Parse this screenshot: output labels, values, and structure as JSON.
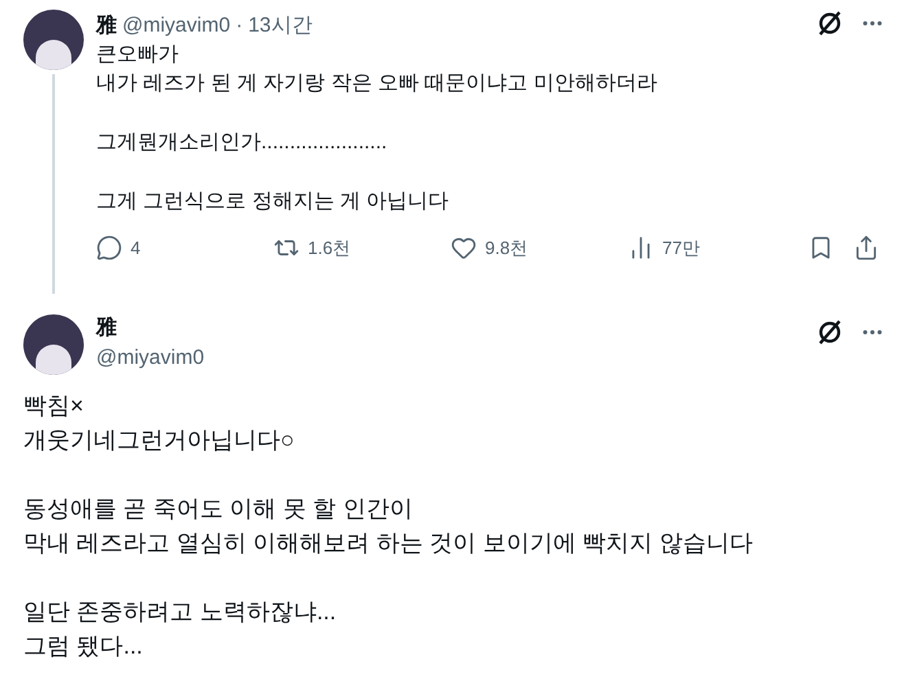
{
  "reply_tweet": {
    "name": "雅",
    "handle": "@miyavim0",
    "separator": "·",
    "time": "13시간",
    "paragraphs": [
      "큰오빠가\n내가 레즈가 된 게 자기랑 작은 오빠 때문이냐고 미안해하더라",
      "그게뭔개소리인가......................",
      "그게 그런식으로 정해지는 게 아닙니다"
    ],
    "actions": [
      {
        "kind": "reply",
        "count": "4"
      },
      {
        "kind": "repost",
        "count": "1.6천"
      },
      {
        "kind": "like",
        "count": "9.8천"
      },
      {
        "kind": "views",
        "count": "77만"
      },
      {
        "kind": "bookmark"
      },
      {
        "kind": "share"
      }
    ]
  },
  "main_tweet": {
    "name": "雅",
    "handle": "@miyavim0",
    "paragraphs": [
      "빡침×\n개웃기네그런거아닙니다○",
      "동성애를 곧 죽어도 이해 못 할 인간이\n막내 레즈라고 열심히 이해해보려 하는 것이 보이기에 빡치지 않습니다",
      "일단 존중하려고 노력하잖냐...\n그럼 됐다..."
    ]
  }
}
